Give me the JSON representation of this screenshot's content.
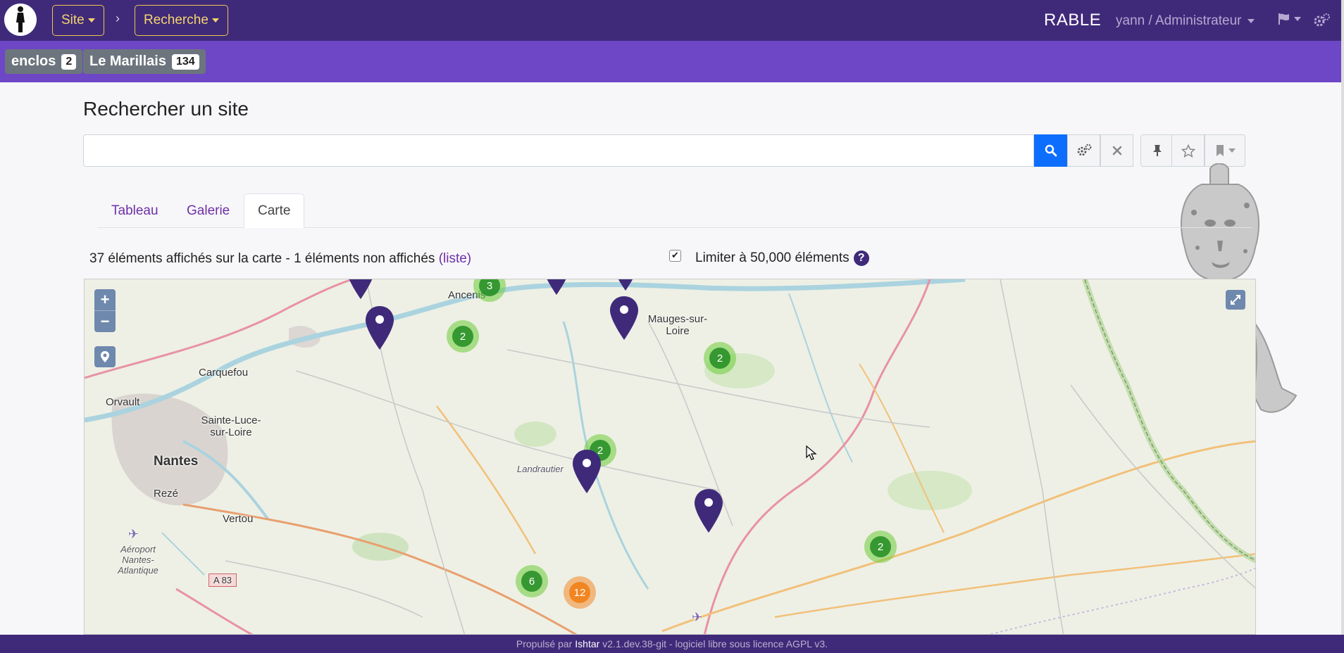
{
  "navbar": {
    "site_label": "Site",
    "separator": "›",
    "search_label": "Recherche",
    "brand": "RABLE",
    "user": "yann / Administrateur"
  },
  "subbar": {
    "chips": [
      {
        "label": "enclos",
        "count": "2"
      },
      {
        "label": "Le Marillais",
        "count": "134"
      }
    ]
  },
  "page": {
    "title": "Rechercher un site",
    "search_value": ""
  },
  "tabs": [
    {
      "label": "Tableau",
      "active": false
    },
    {
      "label": "Galerie",
      "active": false
    },
    {
      "label": "Carte",
      "active": true
    }
  ],
  "map_info": {
    "count_text": "37 éléments affichés sur la carte - 1 éléments non affichés",
    "list_link": "(liste)",
    "limit_label": "Limiter à 50,000 éléments",
    "limit_checked": true,
    "help": "?"
  },
  "map": {
    "zoom_in": "+",
    "zoom_out": "−",
    "labels": [
      "Ancenis",
      "Mauges-sur-Loire",
      "Carquefou",
      "Orvault",
      "Sainte-Luce-sur-Loire",
      "Nantes",
      "Rezé",
      "Vertou",
      "Aéroport Nantes-Atlantique",
      "A 83",
      "Landrautier"
    ],
    "clusters": [
      {
        "count": "3",
        "color": "green"
      },
      {
        "count": "2",
        "color": "green"
      },
      {
        "count": "2",
        "color": "green"
      },
      {
        "count": "2",
        "color": "green"
      },
      {
        "count": "2",
        "color": "green"
      },
      {
        "count": "6",
        "color": "green"
      },
      {
        "count": "12",
        "color": "orange"
      }
    ],
    "colors": {
      "marker": "#3f2a7a",
      "cluster_green": "#228c22",
      "cluster_orange": "#f18017"
    }
  },
  "footer": {
    "prefix": "Propulsé par",
    "link": "Ishtar",
    "suffix": "v2.1.dev.38-git - logiciel libre sous licence AGPL v3."
  }
}
